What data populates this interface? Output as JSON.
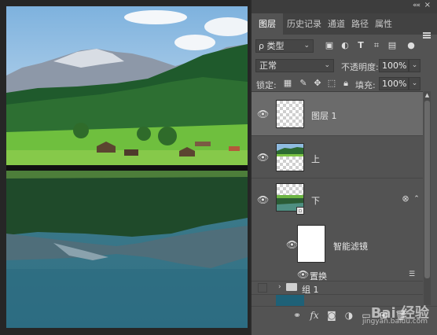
{
  "panel": {
    "collapse_glyph": "««",
    "close_glyph": "×",
    "tabs": [
      {
        "label": "图层",
        "active": true
      },
      {
        "label": "历史记录",
        "active": false
      },
      {
        "label": "通道",
        "active": false
      },
      {
        "label": "路径",
        "active": false
      },
      {
        "label": "属性",
        "active": false
      }
    ],
    "filter": {
      "kind_label": "ρ 类型",
      "chevron": "⌄"
    },
    "blend": {
      "mode": "正常",
      "chevron": "⌄",
      "opacity_label": "不透明度:",
      "opacity_value": "100%"
    },
    "lock": {
      "label": "锁定:",
      "fill_label": "填充:",
      "fill_value": "100%"
    },
    "layers": [
      {
        "name": "图层 1",
        "visible": true,
        "selected": true,
        "type": "transparent"
      },
      {
        "name": "上",
        "visible": true,
        "selected": false,
        "type": "image"
      },
      {
        "name": "下",
        "visible": true,
        "selected": false,
        "type": "smart-object"
      },
      {
        "name": "智能滤镜",
        "visible": true,
        "selected": false,
        "type": "smart-filter-mask"
      },
      {
        "name": "置换",
        "visible": true,
        "selected": false,
        "type": "filter"
      },
      {
        "name": "组 1",
        "visible": false,
        "selected": false,
        "type": "group"
      }
    ],
    "bottom_toolbar": [
      "link-icon",
      "fx-icon",
      "mask-icon",
      "adjustment-icon",
      "folder-icon",
      "new-layer-icon",
      "trash-icon"
    ],
    "watermark": {
      "text": "Bai 经验",
      "url": "jingyan.baidu.com"
    }
  }
}
